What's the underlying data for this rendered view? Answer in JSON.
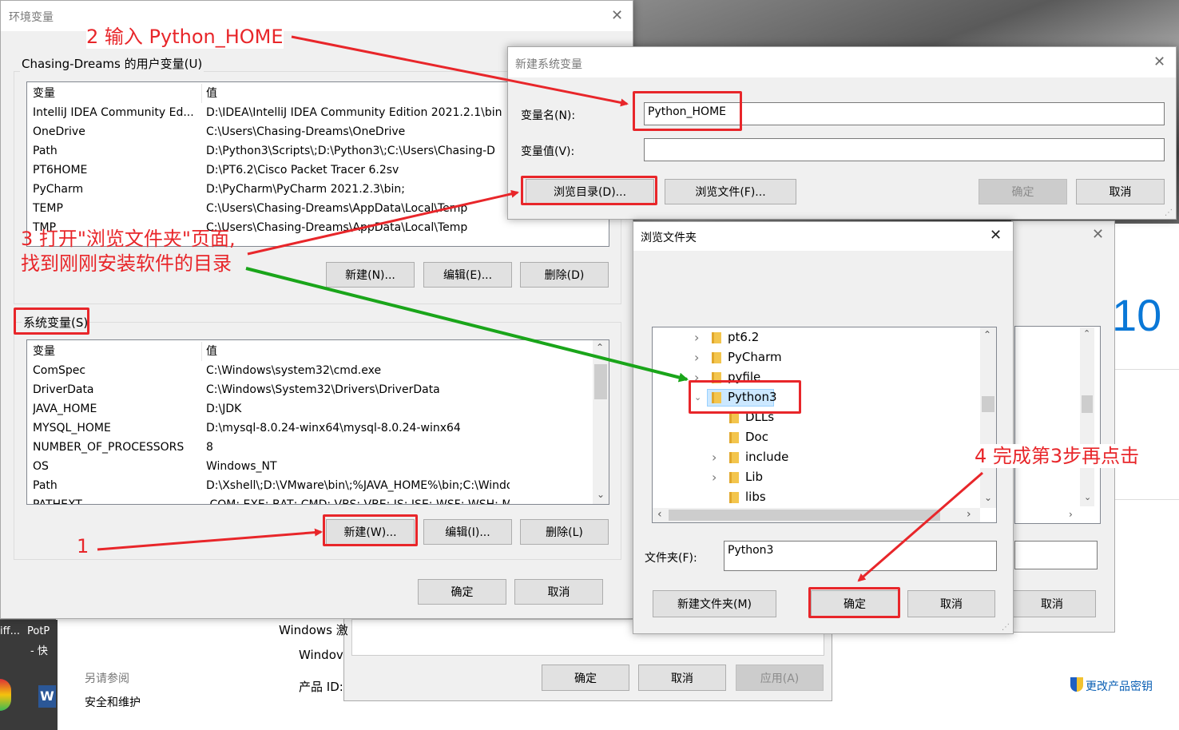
{
  "colors": {
    "annotation": "#e8262a",
    "arrow_green": "#1aa51a",
    "win10_blue": "#0a78d7"
  },
  "env_dialog": {
    "title": "环境变量",
    "user_group_label": "Chasing-Dreams 的用户变量(U)",
    "col_var": "变量",
    "col_val": "值",
    "user_vars": [
      {
        "name": "IntelliJ IDEA Community Ed...",
        "value": "D:\\IDEA\\IntelliJ IDEA Community Edition 2021.2.1\\bin"
      },
      {
        "name": "OneDrive",
        "value": "C:\\Users\\Chasing-Dreams\\OneDrive"
      },
      {
        "name": "Path",
        "value": "D:\\Python3\\Scripts\\;D:\\Python3\\;C:\\Users\\Chasing-D"
      },
      {
        "name": "PT6HOME",
        "value": "D:\\PT6.2\\Cisco Packet Tracer 6.2sv"
      },
      {
        "name": "PyCharm",
        "value": "D:\\PyCharm\\PyCharm 2021.2.3\\bin;"
      },
      {
        "name": "TEMP",
        "value": "C:\\Users\\Chasing-Dreams\\AppData\\Local\\Temp"
      },
      {
        "name": "TMP",
        "value": "C:\\Users\\Chasing-Dreams\\AppData\\Local\\Temp"
      }
    ],
    "user_new": "新建(N)...",
    "user_edit": "编辑(E)...",
    "user_delete": "删除(D)",
    "sys_group_label": "系统变量(S)",
    "sys_vars": [
      {
        "name": "ComSpec",
        "value": "C:\\Windows\\system32\\cmd.exe"
      },
      {
        "name": "DriverData",
        "value": "C:\\Windows\\System32\\Drivers\\DriverData"
      },
      {
        "name": "JAVA_HOME",
        "value": "D:\\JDK"
      },
      {
        "name": "MYSQL_HOME",
        "value": "D:\\mysql-8.0.24-winx64\\mysql-8.0.24-winx64"
      },
      {
        "name": "NUMBER_OF_PROCESSORS",
        "value": "8"
      },
      {
        "name": "OS",
        "value": "Windows_NT"
      },
      {
        "name": "Path",
        "value": "D:\\Xshell\\;D:\\VMware\\bin\\;%JAVA_HOME%\\bin;C:\\Windows\\sys..."
      },
      {
        "name": "PATHEXT",
        "value": ".COM;.EXE;.BAT;.CMD;.VBS;.VBE;.JS;.JSE;.WSF;.WSH;.MSC"
      }
    ],
    "sys_new": "新建(W)...",
    "sys_edit": "编辑(I)...",
    "sys_delete": "删除(L)",
    "ok": "确定",
    "cancel": "取消"
  },
  "new_var_dialog": {
    "title": "新建系统变量",
    "name_label": "变量名(N):",
    "name_value": "Python_HOME",
    "value_label": "变量值(V):",
    "value_value": "",
    "browse_dir": "浏览目录(D)...",
    "browse_file": "浏览文件(F)...",
    "ok": "确定",
    "cancel": "取消"
  },
  "browse_dialog": {
    "title": "浏览文件夹",
    "tree": [
      {
        "label": "pt6.2",
        "level": 0,
        "expandable": true,
        "expanded": false
      },
      {
        "label": "PyCharm",
        "level": 0,
        "expandable": true,
        "expanded": false
      },
      {
        "label": "pyfile",
        "level": 0,
        "expandable": true,
        "expanded": false
      },
      {
        "label": "Python3",
        "level": 0,
        "expandable": true,
        "expanded": true,
        "selected": true
      },
      {
        "label": "DLLs",
        "level": 1,
        "expandable": false,
        "expanded": false
      },
      {
        "label": "Doc",
        "level": 1,
        "expandable": false,
        "expanded": false
      },
      {
        "label": "include",
        "level": 1,
        "expandable": true,
        "expanded": false
      },
      {
        "label": "Lib",
        "level": 1,
        "expandable": true,
        "expanded": false
      },
      {
        "label": "libs",
        "level": 1,
        "expandable": false,
        "expanded": false
      }
    ],
    "folder_label": "文件夹(F):",
    "folder_value": "Python3",
    "new_folder": "新建文件夹(M)",
    "ok": "确定",
    "cancel": "取消"
  },
  "background": {
    "win10_text": "10",
    "windows_label": "Windows 激",
    "windows_label2": "Windov",
    "product_id": "产品 ID:",
    "see_also": "另请参阅",
    "security": "安全和维护",
    "change_key": "更改产品密钥",
    "sys_ok": "确定",
    "sys_cancel": "取消",
    "sys_apply": "应用(A)",
    "right_cancel": "取消",
    "desktop1": "iff...",
    "desktop2": "PotP",
    "desktop3": "- 快"
  },
  "annotations": {
    "step1": "1",
    "step2": "2 输入 Python_HOME",
    "step3_line1": "3 打开\"浏览文件夹\"页面,",
    "step3_line2": "找到刚刚安装软件的目录",
    "step4": "4 完成第3步再点击"
  }
}
